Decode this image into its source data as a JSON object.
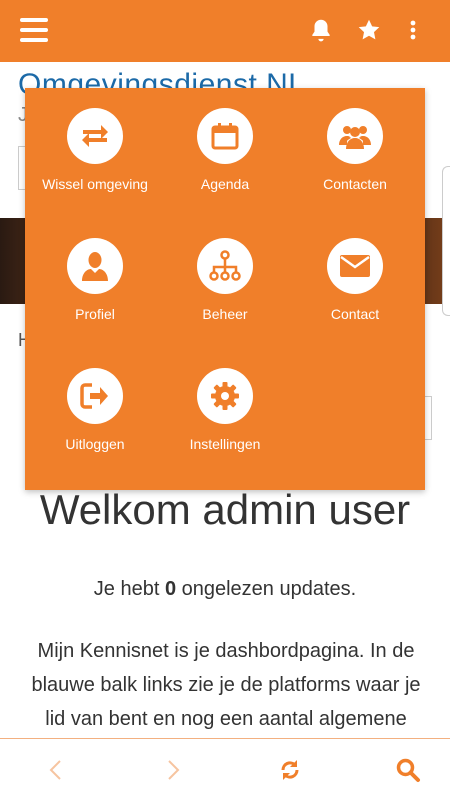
{
  "topbar": {
    "menu_icon": "hamburger-icon",
    "icons": [
      "bell-icon",
      "star-icon",
      "more-vertical-icon"
    ],
    "color": "#f07f2a"
  },
  "page": {
    "site_title": "Omgevingsdienst.NL",
    "site_sub": "J",
    "section_letter": "H",
    "welcome": "Welkom admin user",
    "updates_prefix": "Je hebt ",
    "updates_count": "0",
    "updates_suffix": " ongelezen updates.",
    "intro": "Mijn Kennisnet is je dashbordpagina. In de blauwe balk links zie je de platforms waar je lid van bent en nog een aantal algemene"
  },
  "menu": {
    "items": [
      {
        "label": "Wissel omgeving",
        "icon": "swap-arrows-icon"
      },
      {
        "label": "Agenda",
        "icon": "calendar-icon"
      },
      {
        "label": "Contacten",
        "icon": "users-icon"
      },
      {
        "label": "Profiel",
        "icon": "user-icon"
      },
      {
        "label": "Beheer",
        "icon": "sitemap-icon"
      },
      {
        "label": "Contact",
        "icon": "envelope-icon"
      },
      {
        "label": "Uitloggen",
        "icon": "sign-out-icon"
      },
      {
        "label": "Instellingen",
        "icon": "gear-icon"
      }
    ]
  },
  "bottombar": {
    "icons": [
      "back-arrow-icon",
      "forward-arrow-icon",
      "refresh-icon",
      "search-icon"
    ],
    "accent": "#f07f2a",
    "disabled": "#f6c4a0"
  }
}
